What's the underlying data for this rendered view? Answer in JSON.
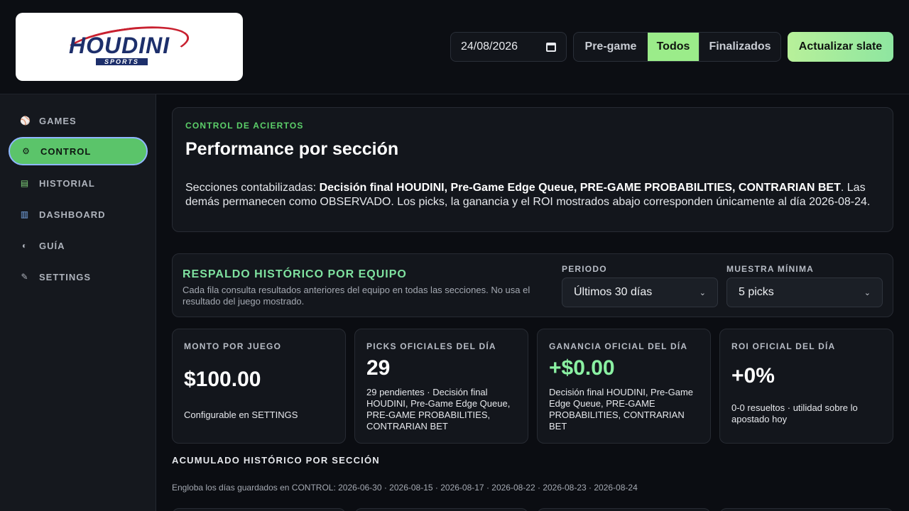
{
  "header": {
    "logo_text": "HOUDINI",
    "logo_sub": "SPORTS",
    "date_value": "24/08/2026",
    "filters": [
      "Pre-game",
      "Todos",
      "Finalizados"
    ],
    "active_filter": "Todos",
    "refresh_label": "Actualizar slate"
  },
  "sidebar": {
    "items": [
      {
        "label": "GAMES",
        "icon": "baseball-icon"
      },
      {
        "label": "CONTROL",
        "icon": "gear-icon"
      },
      {
        "label": "HISTORIAL",
        "icon": "books-icon"
      },
      {
        "label": "DASHBOARD",
        "icon": "bar-chart-icon"
      },
      {
        "label": "GUÍA",
        "icon": "compass-icon"
      },
      {
        "label": "SETTINGS",
        "icon": "wrench-icon"
      }
    ],
    "active": "CONTROL"
  },
  "control": {
    "eyebrow": "CONTROL DE ACIERTOS",
    "title": "Performance por sección",
    "desc_prefix": "Secciones contabilizadas: ",
    "desc_bold": "Decisión final HOUDINI, Pre-Game Edge Queue, PRE-GAME PROBABILITIES, CONTRARIAN BET",
    "desc_suffix": ". Las demás permanecen como OBSERVADO. Los picks, la ganancia y el ROI mostrados abajo corresponden únicamente al día 2026-08-24."
  },
  "respaldo": {
    "title": "RESPALDO HISTÓRICO POR EQUIPO",
    "subtitle": "Cada fila consulta resultados anteriores del equipo en todas las secciones. No usa el resultado del juego mostrado.",
    "periodo_label": "PERIODO",
    "periodo_value": "Últimos 30 días",
    "muestra_label": "MUESTRA MÍNIMA",
    "muestra_value": "5 picks"
  },
  "metrics": [
    {
      "label": "MONTO POR JUEGO",
      "value": "$100.00",
      "note": "Configurable en SETTINGS"
    },
    {
      "label": "PICKS OFICIALES DEL DÍA",
      "value": "29",
      "note": "29 pendientes · Decisión final HOUDINI, Pre-Game Edge Queue, PRE-GAME PROBABILITIES, CONTRARIAN BET"
    },
    {
      "label": "GANANCIA OFICIAL DEL DÍA",
      "value": "+$0.00",
      "note": "Decisión final HOUDINI, Pre-Game Edge Queue, PRE-GAME PROBABILITIES, CONTRARIAN BET"
    },
    {
      "label": "ROI OFICIAL DEL DÍA",
      "value": "+0%",
      "note": "0-0 resueltos · utilidad sobre lo apostado hoy"
    }
  ],
  "acumulado": {
    "title": "ACUMULADO HISTÓRICO POR SECCIÓN",
    "subtitle": "Engloba los días guardados en CONTROL: 2026-06-30 · 2026-08-15 · 2026-08-17 · 2026-08-22 · 2026-08-23 · 2026-08-24"
  },
  "colors": {
    "accent_green": "#5bc46a",
    "profit_green": "#8af0a2",
    "active_filter_bg": "#9bec8a"
  }
}
